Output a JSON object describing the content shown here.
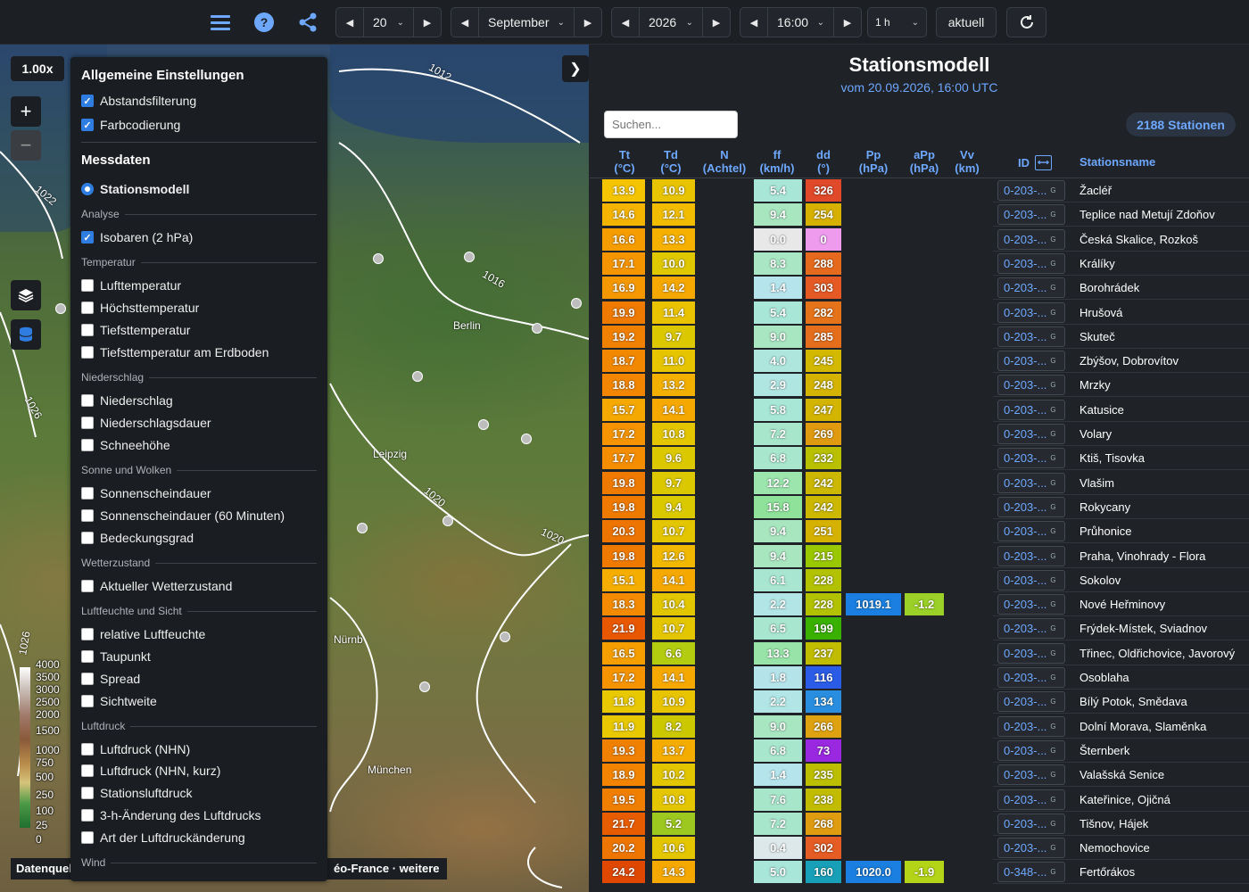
{
  "toolbar": {
    "day": "20",
    "month": "September",
    "year": "2026",
    "time": "16:00",
    "step": "1 h",
    "now_label": "aktuell"
  },
  "map": {
    "zoom_label": "1.00x",
    "zoom_in": "+",
    "zoom_out": "−",
    "datenquelle": "Datenquel",
    "credit": "éo-France · weitere",
    "scale_labels": [
      "4000",
      "3500",
      "3000",
      "2500",
      "2000",
      "1500",
      "1000",
      "750",
      "500",
      "250",
      "100",
      "25",
      "0"
    ],
    "isobar_labels": [
      "1012",
      "1022",
      "1026",
      "1016",
      "1020",
      "1026",
      "1020"
    ],
    "cities": [
      "Berlin",
      "Leipzig",
      "München",
      "Nürnb"
    ]
  },
  "panel": {
    "general_title": "Allgemeine Einstellungen",
    "abstandsfilterung": "Abstandsfilterung",
    "farbcodierung": "Farbcodierung",
    "messdaten_title": "Messdaten",
    "stationsmodell": "Stationsmodell",
    "sec_analyse": "Analyse",
    "isobaren": "Isobaren (2 hPa)",
    "sec_temperatur": "Temperatur",
    "lufttemperatur": "Lufttemperatur",
    "hoechst": "Höchsttemperatur",
    "tiefst": "Tiefsttemperatur",
    "tiefst_boden": "Tiefsttemperatur am Erdboden",
    "sec_niederschlag": "Niederschlag",
    "niederschlag": "Niederschlag",
    "niederschlagsdauer": "Niederschlagsdauer",
    "schneehoehe": "Schneehöhe",
    "sec_sonne": "Sonne und Wolken",
    "sonnenscheindauer": "Sonnenscheindauer",
    "sonnenschein60": "Sonnenscheindauer (60 Minuten)",
    "bedeckung": "Bedeckungsgrad",
    "sec_wetter": "Wetterzustand",
    "aktueller_wetter": "Aktueller Wetterzustand",
    "sec_feuchte": "Luftfeuchte und Sicht",
    "rel_feuchte": "relative Luftfeuchte",
    "taupunkt": "Taupunkt",
    "spread": "Spread",
    "sichtweite": "Sichtweite",
    "sec_luftdruck": "Luftdruck",
    "luftdruck_nhn": "Luftdruck (NHN)",
    "luftdruck_kurz": "Luftdruck (NHN, kurz)",
    "stationsluftdruck": "Stationsluftdruck",
    "aenderung3h": "3-h-Änderung des Luftdrucks",
    "art_aenderung": "Art der Luftdruckänderung",
    "sec_wind": "Wind"
  },
  "table": {
    "title": "Stationsmodell",
    "subtitle": "vom 20.09.2026, 16:00 UTC",
    "search_placeholder": "Suchen...",
    "station_count": "2188 Stationen",
    "headers": {
      "tt": "Tt",
      "tt_u": "(°C)",
      "td": "Td",
      "td_u": "(°C)",
      "n": "N",
      "n_u": "(Achtel)",
      "ff": "ff",
      "ff_u": "(km/h)",
      "dd": "dd",
      "dd_u": "(°)",
      "pp": "Pp",
      "pp_u": "(hPa)",
      "app": "aPp",
      "app_u": "(hPa)",
      "vv": "Vv",
      "vv_u": "(km)",
      "id": "ID",
      "name": "Stationsname"
    },
    "rows": [
      {
        "tt": "13.9",
        "td": "10.9",
        "ff": "5.4",
        "dd": "326",
        "pp": "",
        "app": "",
        "id": "0-203-...",
        "name": "Žacléř",
        "ttc": "#f5c400",
        "tdc": "#e8c400",
        "ffc": "#a8e6d8",
        "ddc": "#e0492a"
      },
      {
        "tt": "14.6",
        "td": "12.1",
        "ff": "9.4",
        "dd": "254",
        "pp": "",
        "app": "",
        "id": "0-203-...",
        "name": "Teplice nad Metují Zdoňov",
        "ttc": "#f5b400",
        "tdc": "#f2bd00",
        "ffc": "#a8e6c0",
        "ddc": "#d7b100"
      },
      {
        "tt": "16.6",
        "td": "13.3",
        "ff": "0.0",
        "dd": "0",
        "pp": "",
        "app": "",
        "id": "0-203-...",
        "name": "Česká Skalice, Rozkoš",
        "ttc": "#f59c00",
        "tdc": "#f5b000",
        "ffc": "#e8e8e8",
        "ddc": "#ee9bee"
      },
      {
        "tt": "17.1",
        "td": "10.0",
        "ff": "8.3",
        "dd": "288",
        "pp": "",
        "app": "",
        "id": "0-203-...",
        "name": "Králíky",
        "ttc": "#f59500",
        "tdc": "#e0c800",
        "ffc": "#a8e6c4",
        "ddc": "#e66a1e"
      },
      {
        "tt": "16.9",
        "td": "14.2",
        "ff": "1.4",
        "dd": "303",
        "pp": "",
        "app": "",
        "id": "0-203-...",
        "name": "Borohrádek",
        "ttc": "#f59800",
        "tdc": "#f5a800",
        "ffc": "#b6e4ec",
        "ddc": "#e55a24"
      },
      {
        "tt": "19.9",
        "td": "11.4",
        "ff": "5.4",
        "dd": "282",
        "pp": "",
        "app": "",
        "id": "0-203-...",
        "name": "Hrušová",
        "ttc": "#ef7a00",
        "tdc": "#eac300",
        "ffc": "#a8e6d8",
        "ddc": "#e5731a"
      },
      {
        "tt": "19.2",
        "td": "9.7",
        "ff": "9.0",
        "dd": "285",
        "pp": "",
        "app": "",
        "id": "0-203-...",
        "name": "Skuteč",
        "ttc": "#f08000",
        "tdc": "#dcc800",
        "ffc": "#a8e6c2",
        "ddc": "#e56e1c"
      },
      {
        "tt": "18.7",
        "td": "11.0",
        "ff": "4.0",
        "dd": "245",
        "pp": "",
        "app": "",
        "id": "0-203-...",
        "name": "Zbýšov, Dobrovítov",
        "ttc": "#f28800",
        "tdc": "#e6c400",
        "ffc": "#aee6de",
        "ddc": "#d2b800"
      },
      {
        "tt": "18.8",
        "td": "13.2",
        "ff": "2.9",
        "dd": "248",
        "pp": "",
        "app": "",
        "id": "0-203-...",
        "name": "Mrzky",
        "ttc": "#f28600",
        "tdc": "#f4b000",
        "ffc": "#b0e6e2",
        "ddc": "#d4b400"
      },
      {
        "tt": "15.7",
        "td": "14.1",
        "ff": "5.8",
        "dd": "247",
        "pp": "",
        "app": "",
        "id": "0-203-...",
        "name": "Katusice",
        "ttc": "#f5a800",
        "tdc": "#f5a800",
        "ffc": "#a8e6d6",
        "ddc": "#d3b400"
      },
      {
        "tt": "17.2",
        "td": "10.8",
        "ff": "7.2",
        "dd": "269",
        "pp": "",
        "app": "",
        "id": "0-203-...",
        "name": "Volary",
        "ttc": "#f59400",
        "tdc": "#e4c600",
        "ffc": "#a8e6cc",
        "ddc": "#e09a10"
      },
      {
        "tt": "17.7",
        "td": "9.6",
        "ff": "6.8",
        "dd": "232",
        "pp": "",
        "app": "",
        "id": "0-203-...",
        "name": "Ktiš, Tisovka",
        "ttc": "#f48e00",
        "tdc": "#dcc800",
        "ffc": "#a8e6ce",
        "ddc": "#b8c000"
      },
      {
        "tt": "19.8",
        "td": "9.7",
        "ff": "12.2",
        "dd": "242",
        "pp": "",
        "app": "",
        "id": "0-203-...",
        "name": "Vlašim",
        "ttc": "#ef7a00",
        "tdc": "#dcc800",
        "ffc": "#9ce6ae",
        "ddc": "#ccb800"
      },
      {
        "tt": "19.8",
        "td": "9.4",
        "ff": "15.8",
        "dd": "242",
        "pp": "",
        "app": "",
        "id": "0-203-...",
        "name": "Rokycany",
        "ttc": "#ef7a00",
        "tdc": "#dac800",
        "ffc": "#8ee29a",
        "ddc": "#ccb800"
      },
      {
        "tt": "20.3",
        "td": "10.7",
        "ff": "9.4",
        "dd": "251",
        "pp": "",
        "app": "",
        "id": "0-203-...",
        "name": "Průhonice",
        "ttc": "#ee7400",
        "tdc": "#e4c600",
        "ffc": "#a8e6c0",
        "ddc": "#d6b200"
      },
      {
        "tt": "19.8",
        "td": "12.6",
        "ff": "9.4",
        "dd": "215",
        "pp": "",
        "app": "",
        "id": "0-203-...",
        "name": "Praha, Vinohrady - Flora",
        "ttc": "#ef7a00",
        "tdc": "#f0b800",
        "ffc": "#a8e6c0",
        "ddc": "#9ac800"
      },
      {
        "tt": "15.1",
        "td": "14.1",
        "ff": "6.1",
        "dd": "228",
        "pp": "",
        "app": "",
        "id": "0-203-...",
        "name": "Sokolov",
        "ttc": "#f5ae00",
        "tdc": "#f5a800",
        "ffc": "#a8e6d2",
        "ddc": "#b2c200"
      },
      {
        "tt": "18.3",
        "td": "10.4",
        "ff": "2.2",
        "dd": "228",
        "pp": "1019.1",
        "app": "-1.2",
        "id": "0-203-...",
        "name": "Nové Heřminovy",
        "ttc": "#f38a00",
        "tdc": "#e2c600",
        "ffc": "#b2e6e6",
        "ddc": "#b2c200",
        "ppc": "#1a7fe0",
        "appc": "#9ad028"
      },
      {
        "tt": "21.9",
        "td": "10.7",
        "ff": "6.5",
        "dd": "199",
        "pp": "",
        "app": "",
        "id": "0-203-...",
        "name": "Frýdek-Místek, Sviadnov",
        "ttc": "#e85800",
        "tdc": "#e4c600",
        "ffc": "#a8e6d0",
        "ddc": "#3ab000"
      },
      {
        "tt": "16.5",
        "td": "6.6",
        "ff": "13.3",
        "dd": "237",
        "pp": "",
        "app": "",
        "id": "0-203-...",
        "name": "Třinec, Oldřichovice, Javorový",
        "ttc": "#f59e00",
        "tdc": "#b4cc10",
        "ffc": "#98e4a8",
        "ddc": "#c0bc00"
      },
      {
        "tt": "17.2",
        "td": "14.1",
        "ff": "1.8",
        "dd": "116",
        "pp": "",
        "app": "",
        "id": "0-203-...",
        "name": "Osoblaha",
        "ttc": "#f59400",
        "tdc": "#f5a800",
        "ffc": "#b4e4ea",
        "ddc": "#2a5ce8"
      },
      {
        "tt": "11.8",
        "td": "10.9",
        "ff": "2.2",
        "dd": "134",
        "pp": "",
        "app": "",
        "id": "0-203-...",
        "name": "Bílý Potok, Smědava",
        "ttc": "#e8c800",
        "tdc": "#e8c400",
        "ffc": "#b2e6e6",
        "ddc": "#2a8ee0"
      },
      {
        "tt": "11.9",
        "td": "8.2",
        "ff": "9.0",
        "dd": "266",
        "pp": "",
        "app": "",
        "id": "0-203-...",
        "name": "Dolní Morava, Slaměnka",
        "ttc": "#e8c800",
        "tdc": "#ccc800",
        "ffc": "#a8e6c2",
        "ddc": "#dea210"
      },
      {
        "tt": "19.3",
        "td": "13.7",
        "ff": "6.8",
        "dd": "73",
        "pp": "",
        "app": "",
        "id": "0-203-...",
        "name": "Šternberk",
        "ttc": "#f08000",
        "tdc": "#f5ac00",
        "ffc": "#a8e6ce",
        "ddc": "#9a28e0"
      },
      {
        "tt": "18.9",
        "td": "10.2",
        "ff": "1.4",
        "dd": "235",
        "pp": "",
        "app": "",
        "id": "0-203-...",
        "name": "Valašská Senice",
        "ttc": "#f28400",
        "tdc": "#e2c600",
        "ffc": "#b6e4ec",
        "ddc": "#bcbe00"
      },
      {
        "tt": "19.5",
        "td": "10.8",
        "ff": "7.6",
        "dd": "238",
        "pp": "",
        "app": "",
        "id": "0-203-...",
        "name": "Kateřinice, Ojičná",
        "ttc": "#f07e00",
        "tdc": "#e4c600",
        "ffc": "#a8e6ca",
        "ddc": "#c2bc00"
      },
      {
        "tt": "21.7",
        "td": "5.2",
        "ff": "7.2",
        "dd": "268",
        "pp": "",
        "app": "",
        "id": "0-203-...",
        "name": "Tišnov, Hájek",
        "ttc": "#e85c00",
        "tdc": "#9cc820",
        "ffc": "#a8e6cc",
        "ddc": "#e09c10"
      },
      {
        "tt": "20.2",
        "td": "10.6",
        "ff": "0.4",
        "dd": "302",
        "pp": "",
        "app": "",
        "id": "0-203-...",
        "name": "Nemochovice",
        "ttc": "#ee7600",
        "tdc": "#e4c600",
        "ffc": "#dce8ea",
        "ddc": "#e55c24"
      },
      {
        "tt": "24.2",
        "td": "14.3",
        "ff": "5.0",
        "dd": "160",
        "pp": "1020.0",
        "app": "-1.9",
        "id": "0-348-...",
        "name": "Fertőrákos",
        "ttc": "#e04800",
        "tdc": "#f5a800",
        "ffc": "#a8e6da",
        "ddc": "#18a0b8",
        "ppc": "#1a7fe0",
        "appc": "#b4d418"
      }
    ]
  },
  "colors": {
    "accent": "#6ea8fe",
    "panel_bg": "#1a1d21",
    "page_bg": "#1f2227"
  }
}
